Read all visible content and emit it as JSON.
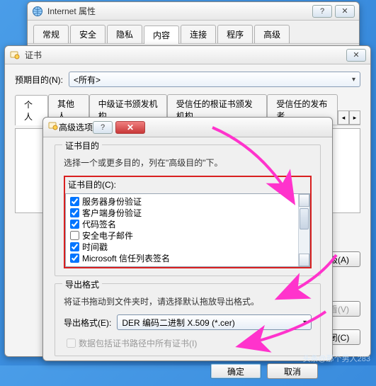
{
  "ie": {
    "title": "Internet 属性",
    "tabs": [
      "常规",
      "安全",
      "隐私",
      "内容",
      "连接",
      "程序",
      "高级"
    ],
    "active_tab_index": 3
  },
  "cert": {
    "title": "证书",
    "purpose_label": "预期目的(N):",
    "purpose_value": "<所有>",
    "tabs": [
      "个人",
      "其他人",
      "中级证书颁发机构",
      "受信任的根证书颁发机构",
      "受信任的发布者"
    ],
    "active_tab_index": 0,
    "buttons": {
      "advanced": "高级(A)",
      "view": "查看(V)",
      "close": "关闭(C)"
    }
  },
  "adv": {
    "title": "高级选项",
    "group_purpose": "证书目的",
    "purpose_hint": "选择一个或更多目的，列在\"高级目的\"下。",
    "purpose_list_label": "证书目的(C):",
    "purposes": [
      {
        "label": "服务器身份验证",
        "checked": true
      },
      {
        "label": "客户端身份验证",
        "checked": true
      },
      {
        "label": "代码签名",
        "checked": true
      },
      {
        "label": "安全电子邮件",
        "checked": false
      },
      {
        "label": "时间戳",
        "checked": true
      },
      {
        "label": "Microsoft 信任列表签名",
        "checked": true
      }
    ],
    "group_export": "导出格式",
    "export_hint": "将证书拖动到文件夹时，请选择默认拖放导出格式。",
    "export_format_label": "导出格式(E):",
    "export_format_value": "DER 编码二进制 X.509 (*.cer)",
    "include_path_label": "数据包括证书路径中所有证书(I)",
    "include_path_checked": false,
    "ok": "确定",
    "cancel": "取消"
  },
  "credit": "头条@那个男人283"
}
